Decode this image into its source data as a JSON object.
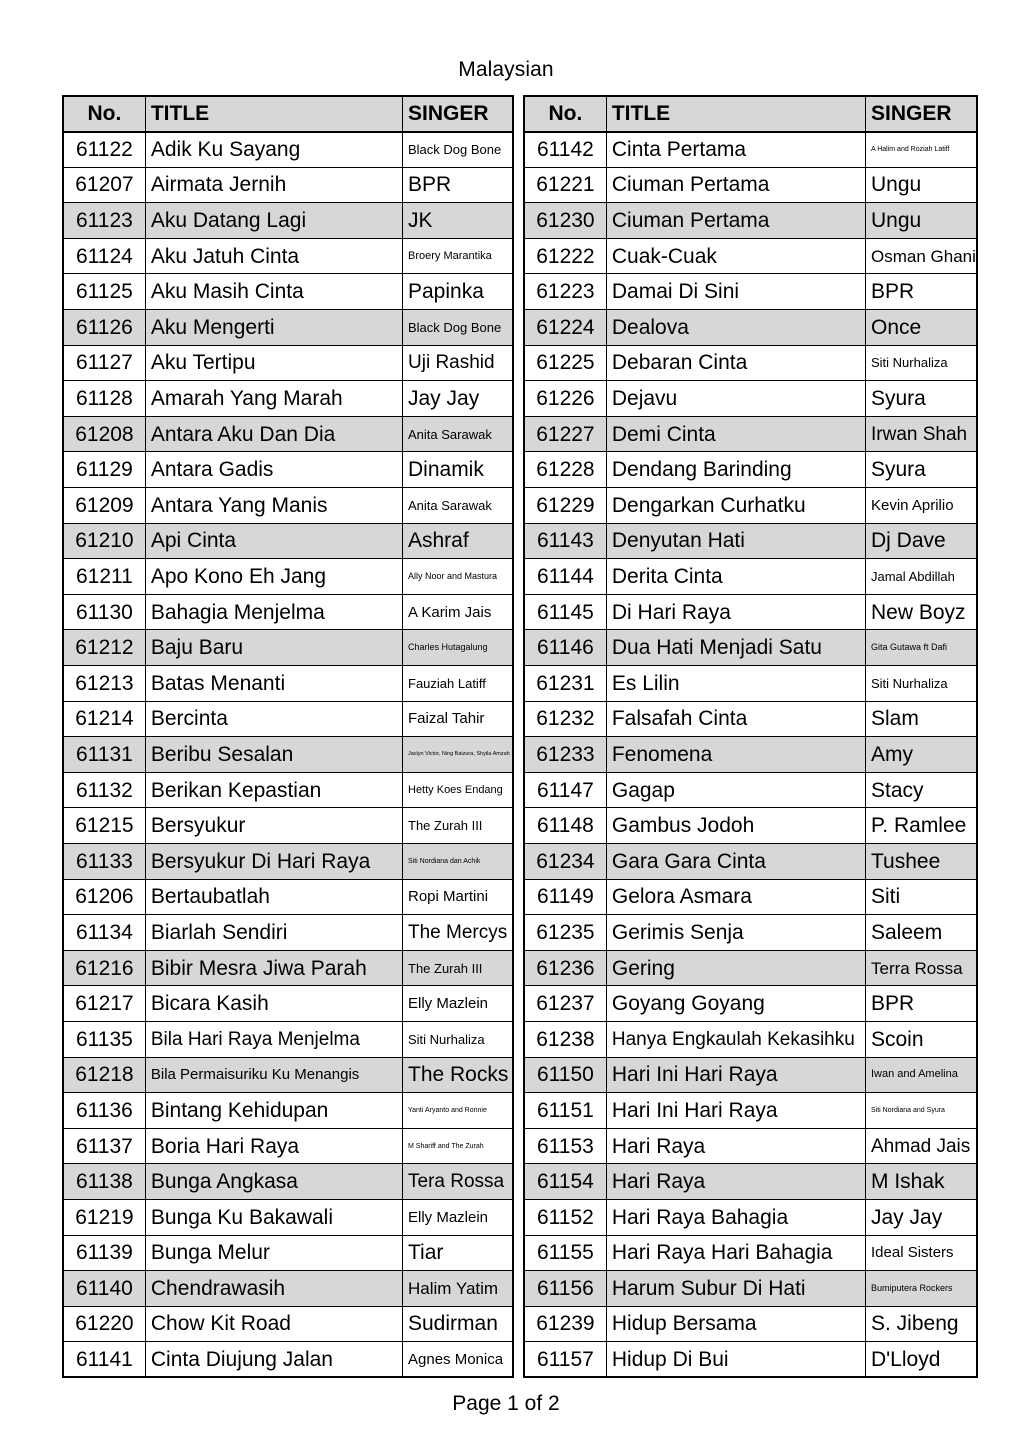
{
  "document": {
    "title": "Malaysian",
    "footer": "Page 1 of 2"
  },
  "columns": {
    "no": "No.",
    "title": "TITLE",
    "singer": "SINGER"
  },
  "tables": [
    {
      "name": "left-table",
      "rows": [
        {
          "no": "61122",
          "title": "Adik Ku Sayang",
          "singer": "Black Dog Bone"
        },
        {
          "no": "61207",
          "title": "Airmata Jernih",
          "singer": "BPR"
        },
        {
          "no": "61123",
          "title": "Aku Datang Lagi",
          "singer": "JK"
        },
        {
          "no": "61124",
          "title": "Aku Jatuh Cinta",
          "singer": "Broery Marantika"
        },
        {
          "no": "61125",
          "title": "Aku Masih Cinta",
          "singer": "Papinka"
        },
        {
          "no": "61126",
          "title": "Aku Mengerti",
          "singer": "Black Dog Bone"
        },
        {
          "no": "61127",
          "title": "Aku Tertipu",
          "singer": "Uji Rashid"
        },
        {
          "no": "61128",
          "title": "Amarah Yang Marah",
          "singer": "Jay Jay"
        },
        {
          "no": "61208",
          "title": "Antara Aku Dan Dia",
          "singer": "Anita Sarawak"
        },
        {
          "no": "61129",
          "title": "Antara Gadis",
          "singer": "Dinamik"
        },
        {
          "no": "61209",
          "title": "Antara Yang Manis",
          "singer": "Anita Sarawak"
        },
        {
          "no": "61210",
          "title": "Api Cinta",
          "singer": "Ashraf"
        },
        {
          "no": "61211",
          "title": "Apo Kono Eh Jang",
          "singer": "Ally Noor and Mastura"
        },
        {
          "no": "61130",
          "title": "Bahagia Menjelma",
          "singer": "A Karim Jais"
        },
        {
          "no": "61212",
          "title": "Baju Baru",
          "singer": "Charles Hutagalung"
        },
        {
          "no": "61213",
          "title": "Batas Menanti",
          "singer": "Fauziah Latiff"
        },
        {
          "no": "61214",
          "title": "Bercinta",
          "singer": "Faizal Tahir"
        },
        {
          "no": "61131",
          "title": "Beribu Sesalan",
          "singer": "Jaclyn Victor, Ning Baizura, Shyila Amzah"
        },
        {
          "no": "61132",
          "title": "Berikan Kepastian",
          "singer": "Hetty Koes Endang"
        },
        {
          "no": "61215",
          "title": "Bersyukur",
          "singer": "The Zurah III"
        },
        {
          "no": "61133",
          "title": "Bersyukur Di Hari Raya",
          "singer": "Siti Nordiana dan Achik"
        },
        {
          "no": "61206",
          "title": "Bertaubatlah",
          "singer": "Ropi Martini"
        },
        {
          "no": "61134",
          "title": "Biarlah Sendiri",
          "singer": "The Mercys"
        },
        {
          "no": "61216",
          "title": "Bibir Mesra Jiwa Parah",
          "singer": "The Zurah III"
        },
        {
          "no": "61217",
          "title": "Bicara Kasih",
          "singer": "Elly Mazlein"
        },
        {
          "no": "61135",
          "title": "Bila Hari Raya Menjelma",
          "singer": "Siti Nurhaliza"
        },
        {
          "no": "61218",
          "title": "Bila Permaisuriku Ku Menangis",
          "singer": "The Rocks"
        },
        {
          "no": "61136",
          "title": "Bintang Kehidupan",
          "singer": "Yanti Aryanto and Ronnie"
        },
        {
          "no": "61137",
          "title": "Boria Hari Raya",
          "singer": "M Shariff and The Zurah"
        },
        {
          "no": "61138",
          "title": "Bunga Angkasa",
          "singer": "Tera Rossa"
        },
        {
          "no": "61219",
          "title": "Bunga Ku Bakawali",
          "singer": "Elly Mazlein"
        },
        {
          "no": "61139",
          "title": "Bunga Melur",
          "singer": "Tiar"
        },
        {
          "no": "61140",
          "title": "Chendrawasih",
          "singer": "Halim Yatim"
        },
        {
          "no": "61220",
          "title": "Chow Kit Road",
          "singer": "Sudirman"
        },
        {
          "no": "61141",
          "title": "Cinta Diujung Jalan",
          "singer": "Agnes Monica"
        }
      ]
    },
    {
      "name": "right-table",
      "rows": [
        {
          "no": "61142",
          "title": "Cinta Pertama",
          "singer": "A Halim and Roziah Latiff"
        },
        {
          "no": "61221",
          "title": "Ciuman Pertama",
          "singer": "Ungu"
        },
        {
          "no": "61230",
          "title": "Ciuman Pertama",
          "singer": "Ungu"
        },
        {
          "no": "61222",
          "title": "Cuak-Cuak",
          "singer": "Osman Ghani"
        },
        {
          "no": "61223",
          "title": "Damai Di Sini",
          "singer": "BPR"
        },
        {
          "no": "61224",
          "title": "Dealova",
          "singer": "Once"
        },
        {
          "no": "61225",
          "title": "Debaran Cinta",
          "singer": "Siti Nurhaliza"
        },
        {
          "no": "61226",
          "title": "Dejavu",
          "singer": "Syura"
        },
        {
          "no": "61227",
          "title": "Demi Cinta",
          "singer": "Irwan Shah"
        },
        {
          "no": "61228",
          "title": "Dendang Barinding",
          "singer": "Syura"
        },
        {
          "no": "61229",
          "title": "Dengarkan Curhatku",
          "singer": "Kevin Aprilio"
        },
        {
          "no": "61143",
          "title": "Denyutan Hati",
          "singer": "Dj Dave"
        },
        {
          "no": "61144",
          "title": "Derita Cinta",
          "singer": "Jamal Abdillah"
        },
        {
          "no": "61145",
          "title": "Di Hari Raya",
          "singer": "New Boyz"
        },
        {
          "no": "61146",
          "title": "Dua Hati Menjadi Satu",
          "singer": "Gita Gutawa ft Dafi"
        },
        {
          "no": "61231",
          "title": "Es Lilin",
          "singer": "Siti Nurhaliza"
        },
        {
          "no": "61232",
          "title": "Falsafah Cinta",
          "singer": "Slam"
        },
        {
          "no": "61233",
          "title": "Fenomena",
          "singer": "Amy"
        },
        {
          "no": "61147",
          "title": "Gagap",
          "singer": "Stacy"
        },
        {
          "no": "61148",
          "title": "Gambus Jodoh",
          "singer": "P. Ramlee"
        },
        {
          "no": "61234",
          "title": "Gara Gara Cinta",
          "singer": "Tushee"
        },
        {
          "no": "61149",
          "title": "Gelora Asmara",
          "singer": "Siti"
        },
        {
          "no": "61235",
          "title": "Gerimis Senja",
          "singer": "Saleem"
        },
        {
          "no": "61236",
          "title": "Gering",
          "singer": "Terra Rossa"
        },
        {
          "no": "61237",
          "title": "Goyang Goyang",
          "singer": "BPR"
        },
        {
          "no": "61238",
          "title": "Hanya Engkaulah Kekasihku",
          "singer": "Scoin"
        },
        {
          "no": "61150",
          "title": "Hari Ini Hari Raya",
          "singer": "Iwan and Amelina"
        },
        {
          "no": "61151",
          "title": "Hari Ini Hari Raya",
          "singer": "Siti Nordiana and Syura"
        },
        {
          "no": "61153",
          "title": "Hari Raya",
          "singer": "Ahmad Jais"
        },
        {
          "no": "61154",
          "title": "Hari Raya",
          "singer": "M Ishak"
        },
        {
          "no": "61152",
          "title": "Hari Raya Bahagia",
          "singer": "Jay Jay"
        },
        {
          "no": "61155",
          "title": "Hari Raya Hari Bahagia",
          "singer": "Ideal Sisters"
        },
        {
          "no": "61156",
          "title": "Harum Subur Di Hati",
          "singer": "Bumiputera Rockers"
        },
        {
          "no": "61239",
          "title": "Hidup Bersama",
          "singer": "S. Jibeng"
        },
        {
          "no": "61157",
          "title": "Hidup Di Bui",
          "singer": "D'Lloyd"
        }
      ]
    }
  ]
}
